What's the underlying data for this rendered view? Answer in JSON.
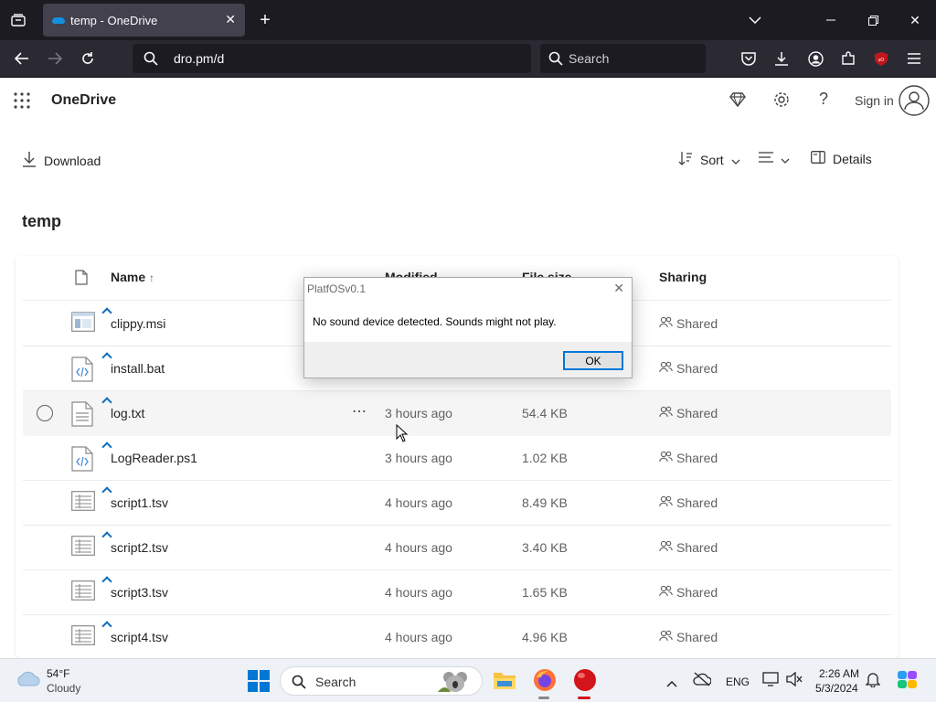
{
  "browser": {
    "tab_title": "temp - OneDrive",
    "url": "dro.pm/d",
    "search_placeholder": "Search"
  },
  "header": {
    "brand": "OneDrive",
    "sign_in": "Sign in"
  },
  "commands": {
    "download": "Download",
    "sort": "Sort",
    "details": "Details"
  },
  "folder_title": "temp",
  "table": {
    "columns": [
      "Name",
      "Modified",
      "File size",
      "Sharing"
    ],
    "sort_indicator": "↑",
    "rows": [
      {
        "name": "clippy.msi",
        "modified": "",
        "size": "",
        "sharing": "Shared",
        "icon": "msi"
      },
      {
        "name": "install.bat",
        "modified": "",
        "size": "",
        "sharing": "Shared",
        "icon": "code"
      },
      {
        "name": "log.txt",
        "modified": "3 hours ago",
        "size": "54.4 KB",
        "sharing": "Shared",
        "icon": "text"
      },
      {
        "name": "LogReader.ps1",
        "modified": "3 hours ago",
        "size": "1.02 KB",
        "sharing": "Shared",
        "icon": "code"
      },
      {
        "name": "script1.tsv",
        "modified": "4 hours ago",
        "size": "8.49 KB",
        "sharing": "Shared",
        "icon": "sheet"
      },
      {
        "name": "script2.tsv",
        "modified": "4 hours ago",
        "size": "3.40 KB",
        "sharing": "Shared",
        "icon": "sheet"
      },
      {
        "name": "script3.tsv",
        "modified": "4 hours ago",
        "size": "1.65 KB",
        "sharing": "Shared",
        "icon": "sheet"
      },
      {
        "name": "script4.tsv",
        "modified": "4 hours ago",
        "size": "4.96 KB",
        "sharing": "Shared",
        "icon": "sheet"
      }
    ]
  },
  "dialog": {
    "title": "PlatfOSv0.1",
    "message": "No sound device detected. Sounds might not play.",
    "ok": "OK"
  },
  "taskbar": {
    "temp": "54°F",
    "weather": "Cloudy",
    "search": "Search",
    "lang": "ENG",
    "time": "2:26 AM",
    "date": "5/3/2024"
  },
  "colors": {
    "accent": "#0f6cbd",
    "titlebar": "#1c1b22",
    "navbar": "#2b2a33"
  }
}
